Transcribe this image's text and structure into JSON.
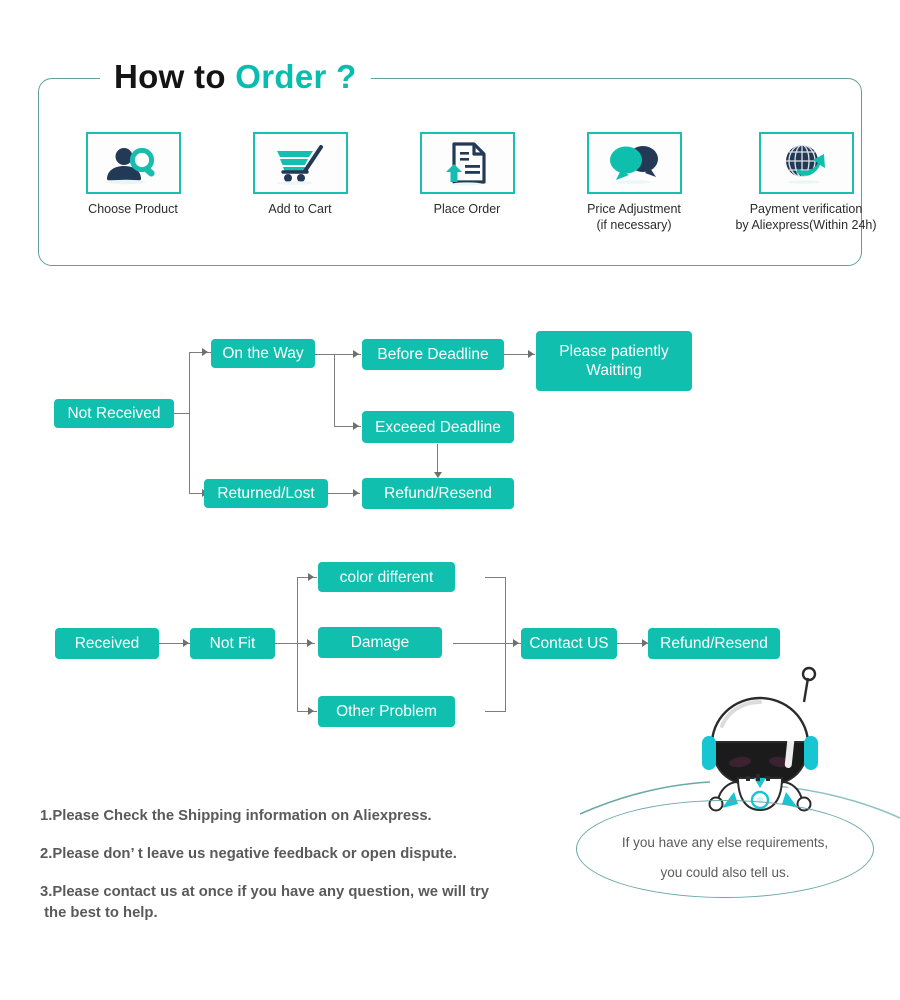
{
  "header": {
    "title_black": "How to ",
    "title_accent": "Order ?",
    "accent_color": "#07bdb0",
    "border_color": "#5f9e9c"
  },
  "steps": [
    {
      "icon": "person-search-icon",
      "label_line1": "Choose  Product",
      "label_line2": ""
    },
    {
      "icon": "shopping-cart-icon",
      "label_line1": "Add to Cart",
      "label_line2": ""
    },
    {
      "icon": "document-upload-icon",
      "label_line1": "Place  Order",
      "label_line2": ""
    },
    {
      "icon": "chat-bubbles-icon",
      "label_line1": "Price Adjustment",
      "label_line2": "(if necessary)"
    },
    {
      "icon": "globe-arrow-icon",
      "label_line1": "Payment verification",
      "label_line2": "by Aliexpress(Within 24h)"
    }
  ],
  "flow_not_received": {
    "box_color": "#10bfae",
    "nodes": {
      "start": "Not Received",
      "on_the_way": "On the Way",
      "returned_lost": "Returned/Lost",
      "before_deadline": "Before Deadline",
      "exceeed_deadline": "Exceeed Deadline",
      "please_wait": "Please patiently\nWaitting",
      "refund_resend": "Refund/Resend"
    }
  },
  "flow_received": {
    "box_color": "#10bfae",
    "nodes": {
      "start": "Received",
      "not_fit": "Not Fit",
      "color_different": "color different",
      "damage": "Damage",
      "other_problem": "Other Problem",
      "contact_us": "Contact US",
      "refund_resend": "Refund/Resend"
    }
  },
  "notes": [
    "1.Please Check the Shipping information on Aliexpress.",
    "2.Please don’ t leave us negative feedback or open dispute.",
    "3.Please contact us at once if you have any question, we will try\n the best to help."
  ],
  "bubble": {
    "line1": "If you have any else requirements,",
    "line2": "you could also tell us.",
    "border_color": "#6aa8a6"
  },
  "mascot": {
    "name": "astronaut-mascot"
  }
}
